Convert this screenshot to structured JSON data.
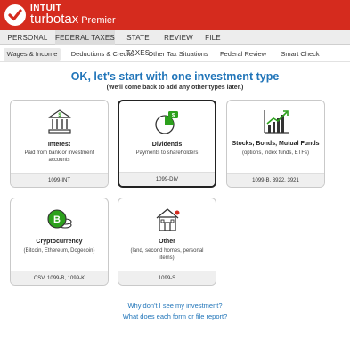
{
  "brand": {
    "company": "INTUIT",
    "product": "turbotax",
    "edition": "Premier"
  },
  "top_nav": [
    "PERSONAL INFO",
    "FEDERAL TAXES",
    "STATE TAXES",
    "REVIEW",
    "FILE"
  ],
  "sub_nav": [
    "Wages & Income",
    "Deductions & Credits",
    "Other Tax Situations",
    "Federal Review",
    "Smart Check"
  ],
  "main": {
    "heading": "OK, let's start with one investment type",
    "subheading": "(We'll come back to add any other types later.)"
  },
  "cards": [
    {
      "title": "Interest",
      "desc": "Paid from bank or investment accounts",
      "forms": "1099-INT",
      "icon": "bank-icon"
    },
    {
      "title": "Dividends",
      "desc": "Payments to shareholders",
      "forms": "1099-DIV",
      "icon": "pie-chart-icon"
    },
    {
      "title": "Stocks, Bonds, Mutual Funds",
      "desc": "(options, index funds, ETFs)",
      "forms": "1099-B, 3922, 3921",
      "icon": "growth-chart-icon"
    },
    {
      "title": "Cryptocurrency",
      "desc": "(Bitcoin, Ethereum, Dogecoin)",
      "forms": "CSV, 1099-B, 1099-K",
      "icon": "bitcoin-icon"
    },
    {
      "title": "Other",
      "desc": "(land, second homes, personal items)",
      "forms": "1099-S",
      "icon": "house-icon"
    }
  ],
  "links": [
    "Why don't I see my investment?",
    "What does each form or file report?"
  ],
  "colors": {
    "brand": "#d52b1e",
    "link": "#2175b9",
    "accent_green": "#2ca01c"
  }
}
